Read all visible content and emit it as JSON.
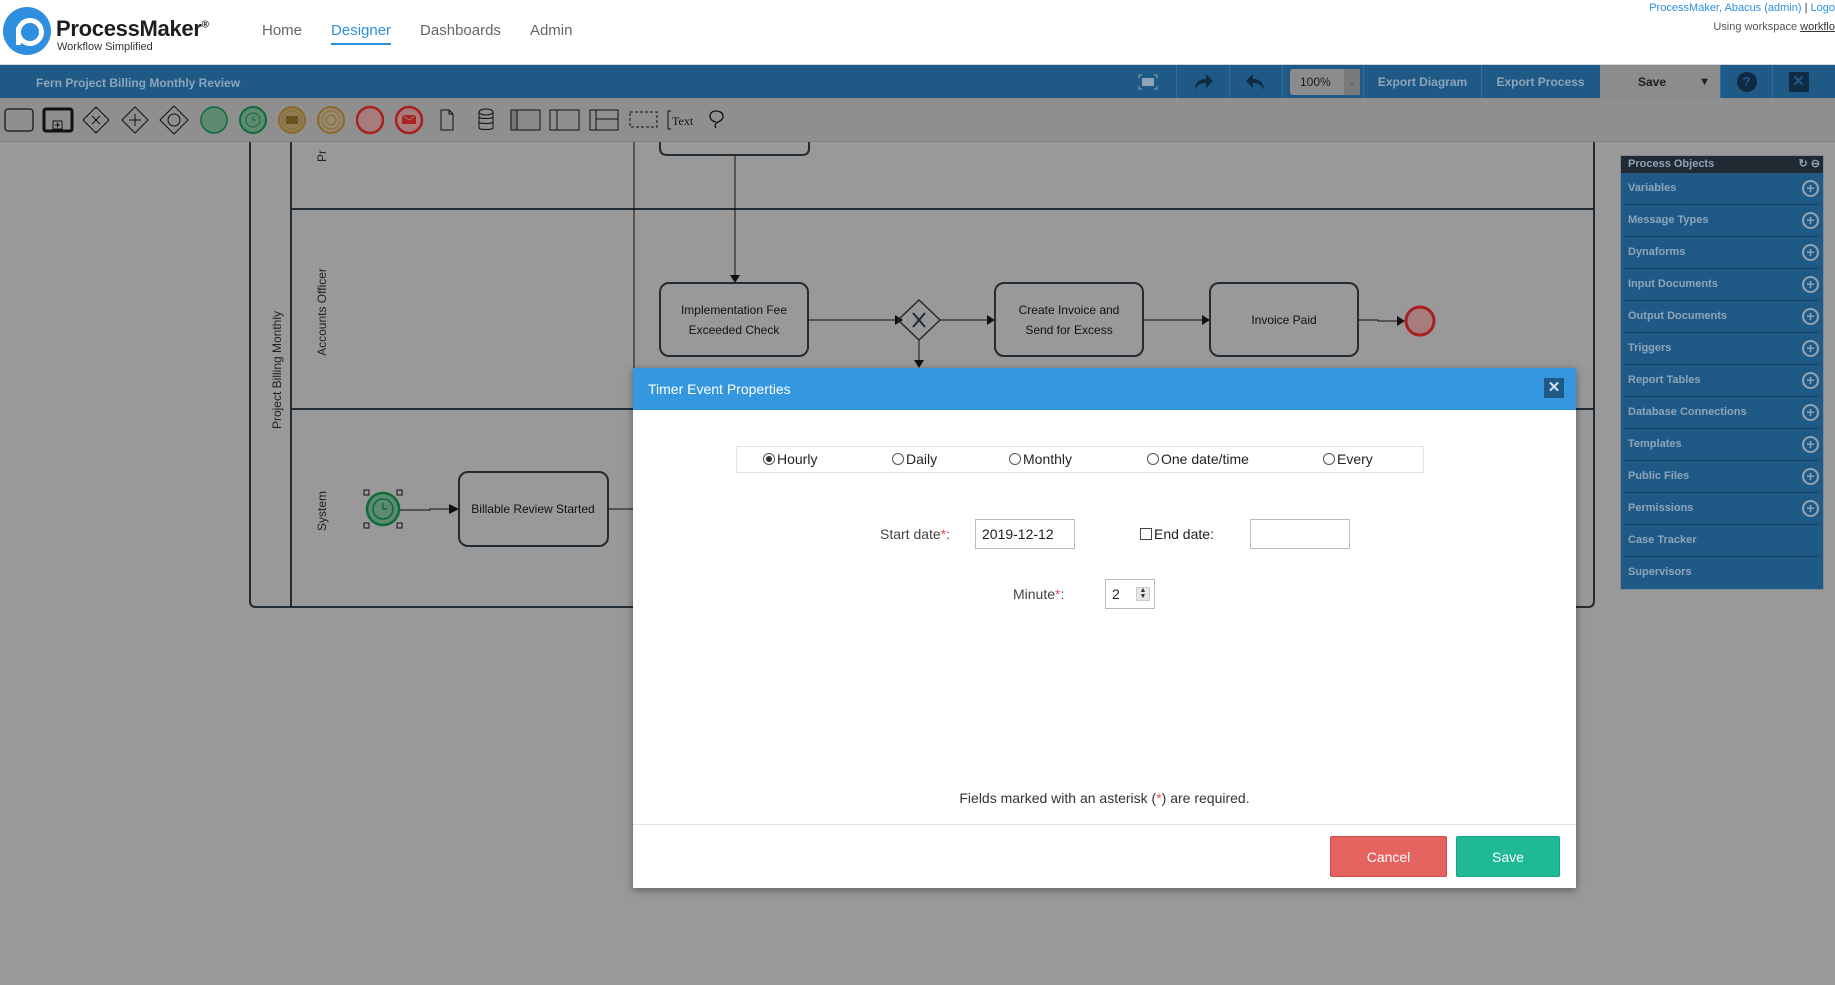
{
  "header": {
    "brand": "ProcessMaker",
    "brand_mark": "®",
    "tagline": "Workflow Simplified",
    "nav": [
      {
        "label": "Home",
        "active": false
      },
      {
        "label": "Designer",
        "active": true
      },
      {
        "label": "Dashboards",
        "active": false
      },
      {
        "label": "Admin",
        "active": false
      }
    ],
    "user_link": "ProcessMaker, Abacus (admin)",
    "separator": "|",
    "logout_link": "Logo",
    "workspace_prefix": "Using workspace",
    "workspace_name": "workflo"
  },
  "designer_bar": {
    "process_title": "Fern Project Billing Monthly Review",
    "zoom_level": "100%",
    "zoom_arrow": "⌄",
    "export_diagram": "Export Diagram",
    "export_process": "Export Process",
    "save_label": "Save",
    "save_caret": "▼",
    "help_label": "?",
    "close_label": "✕"
  },
  "shape_toolbar": {
    "items": [
      "task",
      "sub-process",
      "exclusive-gateway",
      "parallel-gateway",
      "inclusive-gateway",
      "start-event",
      "start-timer-event",
      "intermediate-message-event",
      "intermediate-timer-event",
      "end-event",
      "end-message-event",
      "data-object",
      "data-store",
      "pool",
      "lane",
      "lane-split",
      "group",
      "text-annotation",
      "lasso"
    ],
    "text_tool_label": "Text"
  },
  "diagram": {
    "pool_label": "Project Billing Monthly",
    "lanes": [
      {
        "label": "Pr"
      },
      {
        "label": "Accounts Officer"
      },
      {
        "label": "System"
      }
    ],
    "tasks": [
      {
        "label_lines": [
          "Implementation Fee",
          "Exceeded Check"
        ]
      },
      {
        "label_lines": [
          "Create Invoice and",
          "Send for Excess"
        ]
      },
      {
        "label_lines": [
          "Invoice Paid"
        ]
      },
      {
        "label_lines": [
          "Billable Review Started"
        ]
      }
    ]
  },
  "process_objects": {
    "title": "Process Objects",
    "refresh_icon": "↻",
    "collapse_icon": "⊖",
    "items": [
      {
        "label": "Variables",
        "addable": true
      },
      {
        "label": "Message Types",
        "addable": true
      },
      {
        "label": "Dynaforms",
        "addable": true
      },
      {
        "label": "Input Documents",
        "addable": true
      },
      {
        "label": "Output Documents",
        "addable": true
      },
      {
        "label": "Triggers",
        "addable": true
      },
      {
        "label": "Report Tables",
        "addable": true
      },
      {
        "label": "Database Connections",
        "addable": true
      },
      {
        "label": "Templates",
        "addable": true
      },
      {
        "label": "Public Files",
        "addable": true
      },
      {
        "label": "Permissions",
        "addable": true
      },
      {
        "label": "Case Tracker",
        "addable": false
      },
      {
        "label": "Supervisors",
        "addable": false
      }
    ]
  },
  "dialog": {
    "title": "Timer Event Properties",
    "close_label": "✕",
    "frequency_options": [
      {
        "label": "Hourly",
        "selected": true
      },
      {
        "label": "Daily",
        "selected": false
      },
      {
        "label": "Monthly",
        "selected": false
      },
      {
        "label": "One date/time",
        "selected": false
      },
      {
        "label": "Every",
        "selected": false
      }
    ],
    "start_date_label": "Start date",
    "start_date_value": "2019-12-12",
    "end_date_label": "End date:",
    "end_date_checked": false,
    "end_date_value": "",
    "minute_label": "Minute",
    "minute_value": "2",
    "required_mark": "*",
    "colon": ":",
    "note_prefix": "Fields marked with an asterisk (",
    "note_suffix": ") are required.",
    "cancel_label": "Cancel",
    "save_label": "Save"
  },
  "colors": {
    "brand_blue": "#2d8fdd",
    "designer_bar": "#1f5a87",
    "dialog_header": "#3497e0",
    "cancel": "#e5635e",
    "save": "#1fb996",
    "required": "#e45050"
  }
}
